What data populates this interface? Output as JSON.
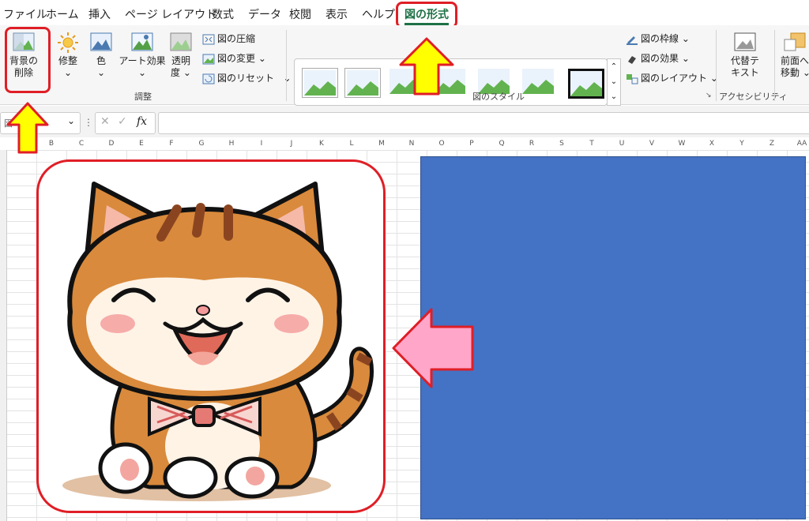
{
  "menu": {
    "items": [
      "ファイル",
      "ホーム",
      "挿入",
      "ページ レイアウト",
      "数式",
      "データ",
      "校閲",
      "表示",
      "ヘルプ"
    ],
    "active": "図の形式"
  },
  "ribbon": {
    "remove_bg": [
      "背景の",
      "削除"
    ],
    "corrections": "修整",
    "color": "色",
    "artistic": "アート効果",
    "transparency": [
      "透明",
      "度"
    ],
    "compress": "図の圧縮",
    "change": "図の変更",
    "reset": "図のリセット",
    "group_adjust": "調整",
    "group_styles": "図のスタイル",
    "border": "図の枠線",
    "effects": "図の効果",
    "layout": "図のレイアウト",
    "alt_text": [
      "代替テ",
      "キスト"
    ],
    "group_accessibility": "アクセシビリティ",
    "bring_forward": [
      "前面へ",
      "移動"
    ]
  },
  "formula": {
    "namebox": "図",
    "fx": "fx"
  },
  "columns": [
    "B",
    "C",
    "D",
    "E",
    "F",
    "G",
    "H",
    "I",
    "J",
    "K",
    "L",
    "M",
    "N",
    "O",
    "P",
    "Q",
    "R",
    "S",
    "T",
    "U",
    "V",
    "W",
    "X",
    "Y",
    "Z",
    "AA"
  ],
  "colors": {
    "accent": "#1e7145",
    "highlight": "#e01e26",
    "arrow_yellow": "#ffff00",
    "arrow_pink": "#ffa6c9",
    "shape_blue": "#4472c4"
  }
}
